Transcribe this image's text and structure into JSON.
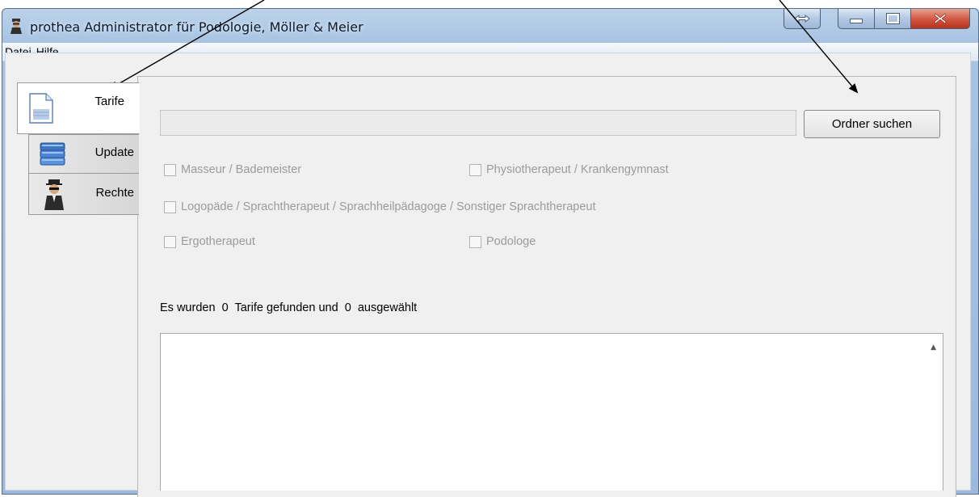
{
  "window": {
    "title": "prothea Administrator für Podologie, Möller & Meier"
  },
  "menu": [
    {
      "label": "Datei"
    },
    {
      "label": "Hilfe"
    }
  ],
  "tabs": [
    {
      "label": "Tarife",
      "icon": "document-icon",
      "active": true
    },
    {
      "label": "Update",
      "icon": "database-icon",
      "active": false
    },
    {
      "label": "Rechte",
      "icon": "agent-icon",
      "active": false
    }
  ],
  "folder": {
    "path_value": "",
    "button_label": "Ordner suchen"
  },
  "checkboxes": {
    "masseur": "Masseur / Bademeister",
    "physio": "Physiotherapeut / Krankengymnast",
    "logo": "Logopäde / Sprachtherapeut / Sprachheilpädagoge / Sonstiger Sprachtherapeut",
    "ergo": "Ergotherapeut",
    "podologe": "Podologe"
  },
  "status": {
    "prefix": "Es wurden ",
    "found": "0",
    "middle": " Tarife gefunden und ",
    "selected": "0",
    "suffix": " ausgewählt"
  },
  "colors": {
    "close_button": "#c8422b",
    "title_bar": "#b2cbe6"
  }
}
